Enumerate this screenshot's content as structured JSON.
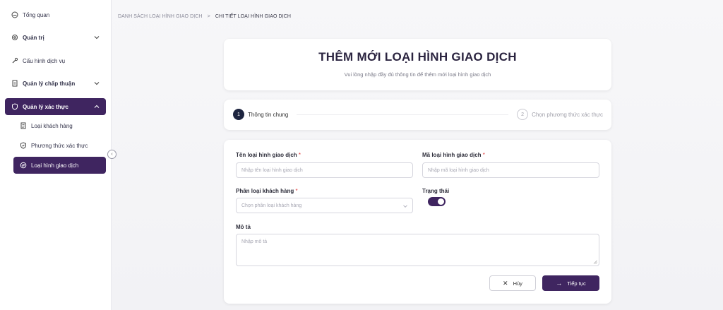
{
  "sidebar": {
    "items": [
      {
        "label": "Tổng quan",
        "icon": "dashboard-icon"
      },
      {
        "label": "Quản trị",
        "icon": "gear-icon"
      },
      {
        "label": "Cấu hình dịch vụ",
        "icon": "wrench-icon"
      },
      {
        "label": "Quản lý chấp thuận",
        "icon": "document-icon"
      },
      {
        "label": "Quản lý xác thực",
        "icon": "shield-icon"
      },
      {
        "label": "Loại khách hàng",
        "icon": "list-icon"
      },
      {
        "label": "Phương thức xác thực",
        "icon": "shield-check-icon"
      },
      {
        "label": "Loại hình giao dịch",
        "icon": "transaction-icon"
      }
    ],
    "collapse_glyph": "‹"
  },
  "breadcrumb": {
    "parent": "DANH SÁCH LOẠI HÌNH GIAO DỊCH",
    "separator": ">",
    "current": "CHI TIẾT LOẠI HÌNH GIAO DỊCH"
  },
  "header": {
    "title": "THÊM MỚI LOẠI HÌNH GIAO DỊCH",
    "subtitle": "Vui lòng nhập đầy đủ thông tin để thêm mới loại hình giao dịch"
  },
  "steps": [
    {
      "num": "1",
      "label": "Thông tin chung"
    },
    {
      "num": "2",
      "label": "Chọn phương thức xác thực"
    }
  ],
  "form": {
    "name_label": "Tên loại hình giao dịch",
    "name_placeholder": "Nhập tên loại hình giao dịch",
    "code_label": "Mã loại hình giao dịch",
    "code_placeholder": "Nhập mã loại hình giao dịch",
    "customer_label": "Phân loại khách hàng",
    "customer_placeholder": "Chọn phân loại khách hàng",
    "status_label": "Trạng thái",
    "status_on": true,
    "desc_label": "Mô tả",
    "desc_placeholder": "Nhập mô tả",
    "required_mark": "*"
  },
  "buttons": {
    "cancel": "Hủy",
    "next": "Tiếp tục"
  },
  "colors": {
    "primary": "#3f2560",
    "required": "#e03b3b"
  }
}
